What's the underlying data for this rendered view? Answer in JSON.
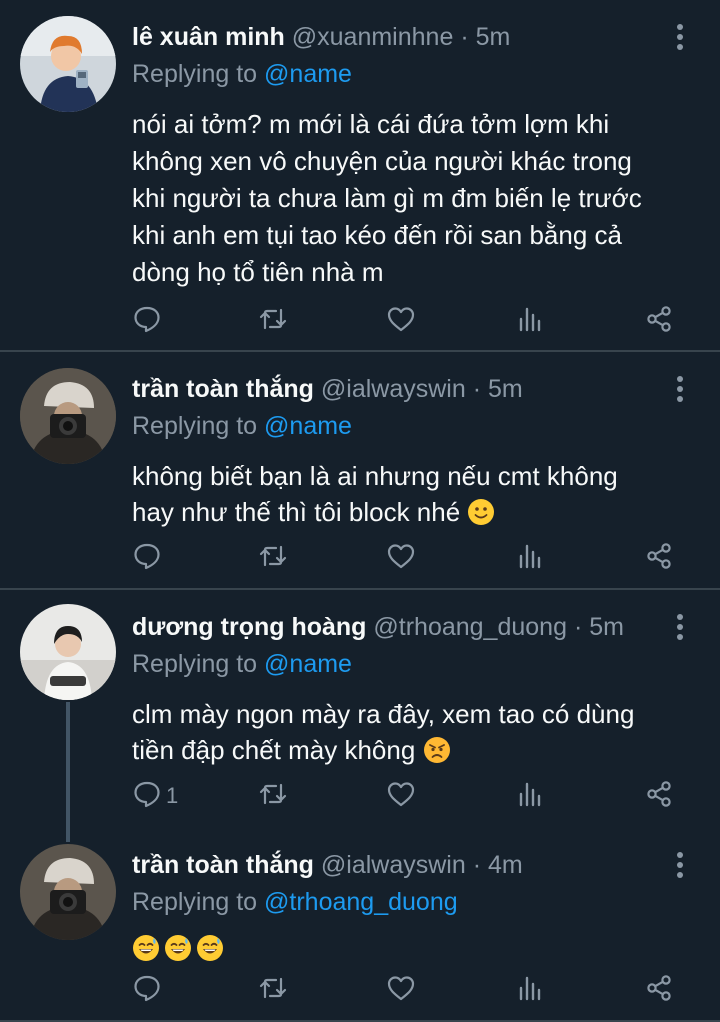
{
  "colors": {
    "background": "#15202b",
    "divider": "#38444d",
    "muted": "#8b98a5",
    "link": "#1d9bf0",
    "text": "#f7f9f9"
  },
  "tweets": [
    {
      "name": "lê xuân minh",
      "handle": "@xuanminhne",
      "dot": "·",
      "time": "5m",
      "replying_prefix": "Replying to",
      "replying_to": "@name",
      "text": "nói ai tởm? m mới là cái đứa tởm lợm khi không xen vô chuyện của người khác trong khi người ta chưa làm gì m đm biến lẹ trước khi anh em tụi tao kéo đến rồi san bằng cả dòng họ tổ tiên nhà m",
      "reply_count": ""
    },
    {
      "name": "trần toàn thắng",
      "handle": "@ialwayswin",
      "dot": "·",
      "time": "5m",
      "replying_prefix": "Replying to",
      "replying_to": "@name",
      "text": "không biết bạn là ai nhưng nếu cmt không hay như thế thì tôi block nhé",
      "emoji": "slightly-smiling-face",
      "reply_count": ""
    },
    {
      "name": "dương trọng hoàng",
      "handle": "@trhoang_duong",
      "dot": "·",
      "time": "5m",
      "replying_prefix": "Replying to",
      "replying_to": "@name",
      "text": "clm mày ngon mày ra đây, xem tao có dùng tiền đập chết mày không",
      "emoji": "angry-face",
      "reply_count": "1"
    },
    {
      "name": "trần toàn thắng",
      "handle": "@ialwayswin",
      "dot": "·",
      "time": "4m",
      "replying_prefix": "Replying to",
      "replying_to": "@trhoang_duong",
      "text": "",
      "emoji": "grinning-sweat-face ×3",
      "reply_count": ""
    }
  ],
  "icons": [
    "reply-icon",
    "retweet-icon",
    "like-icon",
    "views-icon",
    "share-icon",
    "more-icon"
  ]
}
